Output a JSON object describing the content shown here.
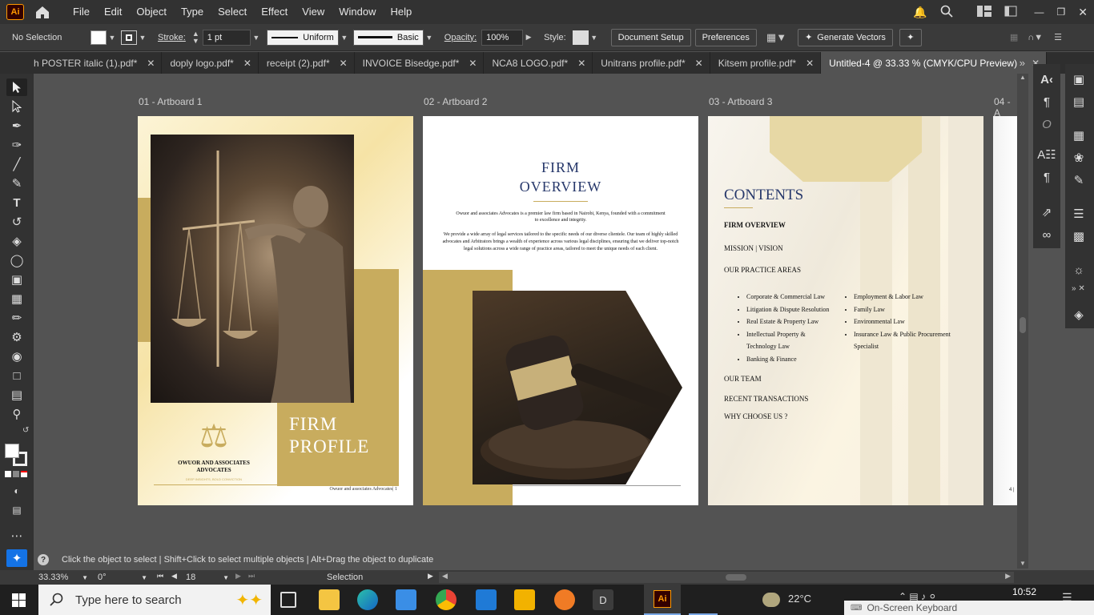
{
  "menubar": {
    "logo": "Ai",
    "items": [
      "File",
      "Edit",
      "Object",
      "Type",
      "Select",
      "Effect",
      "View",
      "Window",
      "Help"
    ]
  },
  "control": {
    "selection": "No Selection",
    "stroke_label": "Stroke:",
    "stroke_weight": "1 pt",
    "stroke_profile": "Uniform",
    "brush": "Basic",
    "opacity_label": "Opacity:",
    "opacity_value": "100%",
    "style_label": "Style:",
    "document_setup": "Document Setup",
    "preferences": "Preferences",
    "generate_vectors": "Generate Vectors"
  },
  "tabs": [
    {
      "label": "h POSTER italic (1).pdf*"
    },
    {
      "label": "doply logo.pdf*"
    },
    {
      "label": "receipt (2).pdf*"
    },
    {
      "label": "INVOICE  Bisedge.pdf*"
    },
    {
      "label": "NCA8 LOGO.pdf*"
    },
    {
      "label": "Unitrans profile.pdf*"
    },
    {
      "label": "Kitsem profile.pdf*"
    },
    {
      "label": "Untitled-4 @ 33.33 % (CMYK/CPU Preview)"
    }
  ],
  "artboards": [
    {
      "label": "01 - Artboard 1"
    },
    {
      "label": "02 - Artboard 2"
    },
    {
      "label": "03 - Artboard 3"
    },
    {
      "label": "04 - A"
    }
  ],
  "ab1": {
    "firm_name": "OWUOR AND ASSOCIATES\nADVOCATES",
    "tagline": "DEEP INSIGHTS, BOLD CONVICTION",
    "title1": "FIRM",
    "title2": "PROFILE",
    "footer": "Owuor and associates Advocates| 1"
  },
  "ab2": {
    "title1": "FIRM",
    "title2": "OVERVIEW",
    "para1": "Owuor and associates Advocates is a premier law firm based in Nairobi, Kenya, founded with a commitment to excellence and integrity.",
    "para2": "We provide a wide array of legal services tailored to the specific needs of our diverse clientele. Our team of highly skilled advocates and Arbitrators brings a wealth of experience across various legal disciplines, ensuring that we deliver top-notch legal solutions across a wide range of practice areas, tailored to meet the unique needs of each client."
  },
  "ab3": {
    "title": "CONTENTS",
    "items": [
      "FIRM OVERVIEW",
      "MISSION | VISION",
      "OUR PRACTICE AREAS"
    ],
    "practice_left": [
      "Corporate & Commercial Law",
      "Litigation & Dispute Resolution",
      "Real Estate & Property Law",
      "Intellectual Property &\nTechnology Law",
      "Banking & Finance"
    ],
    "practice_right": [
      "Employment & Labor Law",
      "Family Law",
      "Environmental Law",
      "Insurance Law & Public Procurement\nSpecialist"
    ],
    "items2": [
      "OUR TEAM",
      "RECENT TRANSACTIONS",
      "WHY CHOOSE US ?"
    ]
  },
  "ab4": {
    "page": "4 |"
  },
  "hint": {
    "icon": "?",
    "text": "Click the object to select  |  Shift+Click to select multiple objects  |  Alt+Drag the object to duplicate"
  },
  "status": {
    "zoom": "33.33%",
    "rotation": "0°",
    "artboard_num": "18",
    "tool": "Selection"
  },
  "taskbar": {
    "search_placeholder": "Type here to search",
    "weather": "22°C",
    "time": "10:52",
    "keyboard": "On-Screen Keyboard"
  },
  "colors": {
    "gold": "#c8ac5e",
    "navy": "#27386b",
    "ui_dark": "#323232"
  }
}
